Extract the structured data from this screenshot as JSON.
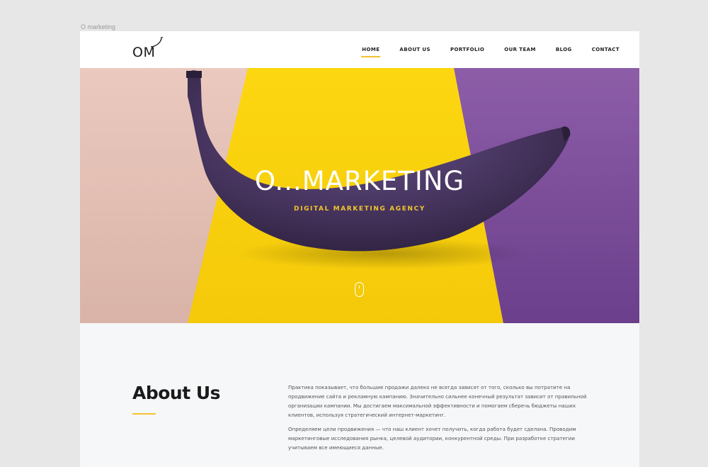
{
  "window": {
    "caption": "O marketing"
  },
  "header": {
    "logo_text": "OM",
    "nav": [
      {
        "label": "HOME",
        "active": true
      },
      {
        "label": "ABOUT US",
        "active": false
      },
      {
        "label": "PORTFOLIO",
        "active": false
      },
      {
        "label": "OUR TEAM",
        "active": false
      },
      {
        "label": "BLOG",
        "active": false
      },
      {
        "label": "CONTACT",
        "active": false
      }
    ]
  },
  "hero": {
    "title": "O...MARKETING",
    "subtitle": "DIGITAL MARKETING AGENCY",
    "scroll_icon": "mouse-scroll-icon"
  },
  "about": {
    "title": "About Us",
    "paragraphs": [
      "Практика показывает, что большие продажи далеко не всегда зависят от того, сколько вы потратите на продвижение сайта и рекламную кампанию. Значительно сильнее конечный результат зависит от правильной организации кампании. Мы достигаем максимальной эффективности и помогаем сберечь бюджеты наших клиентов, используя стратегический интернет-маркетинг.",
      "Определяем цели продвижения — что наш клиент хочет получить, когда работа будет сделана. Проводим маркетинговые исследования рынка, целевой аудитории, конкурентной среды. При разработке стратегии учитываем все имеющиеся данные."
    ]
  },
  "colors": {
    "accent": "#f2c230",
    "hero_pink": "#e8c5bb",
    "hero_yellow": "#fbd20f",
    "hero_purple": "#7a4f9a",
    "banana": "#4a3760"
  }
}
